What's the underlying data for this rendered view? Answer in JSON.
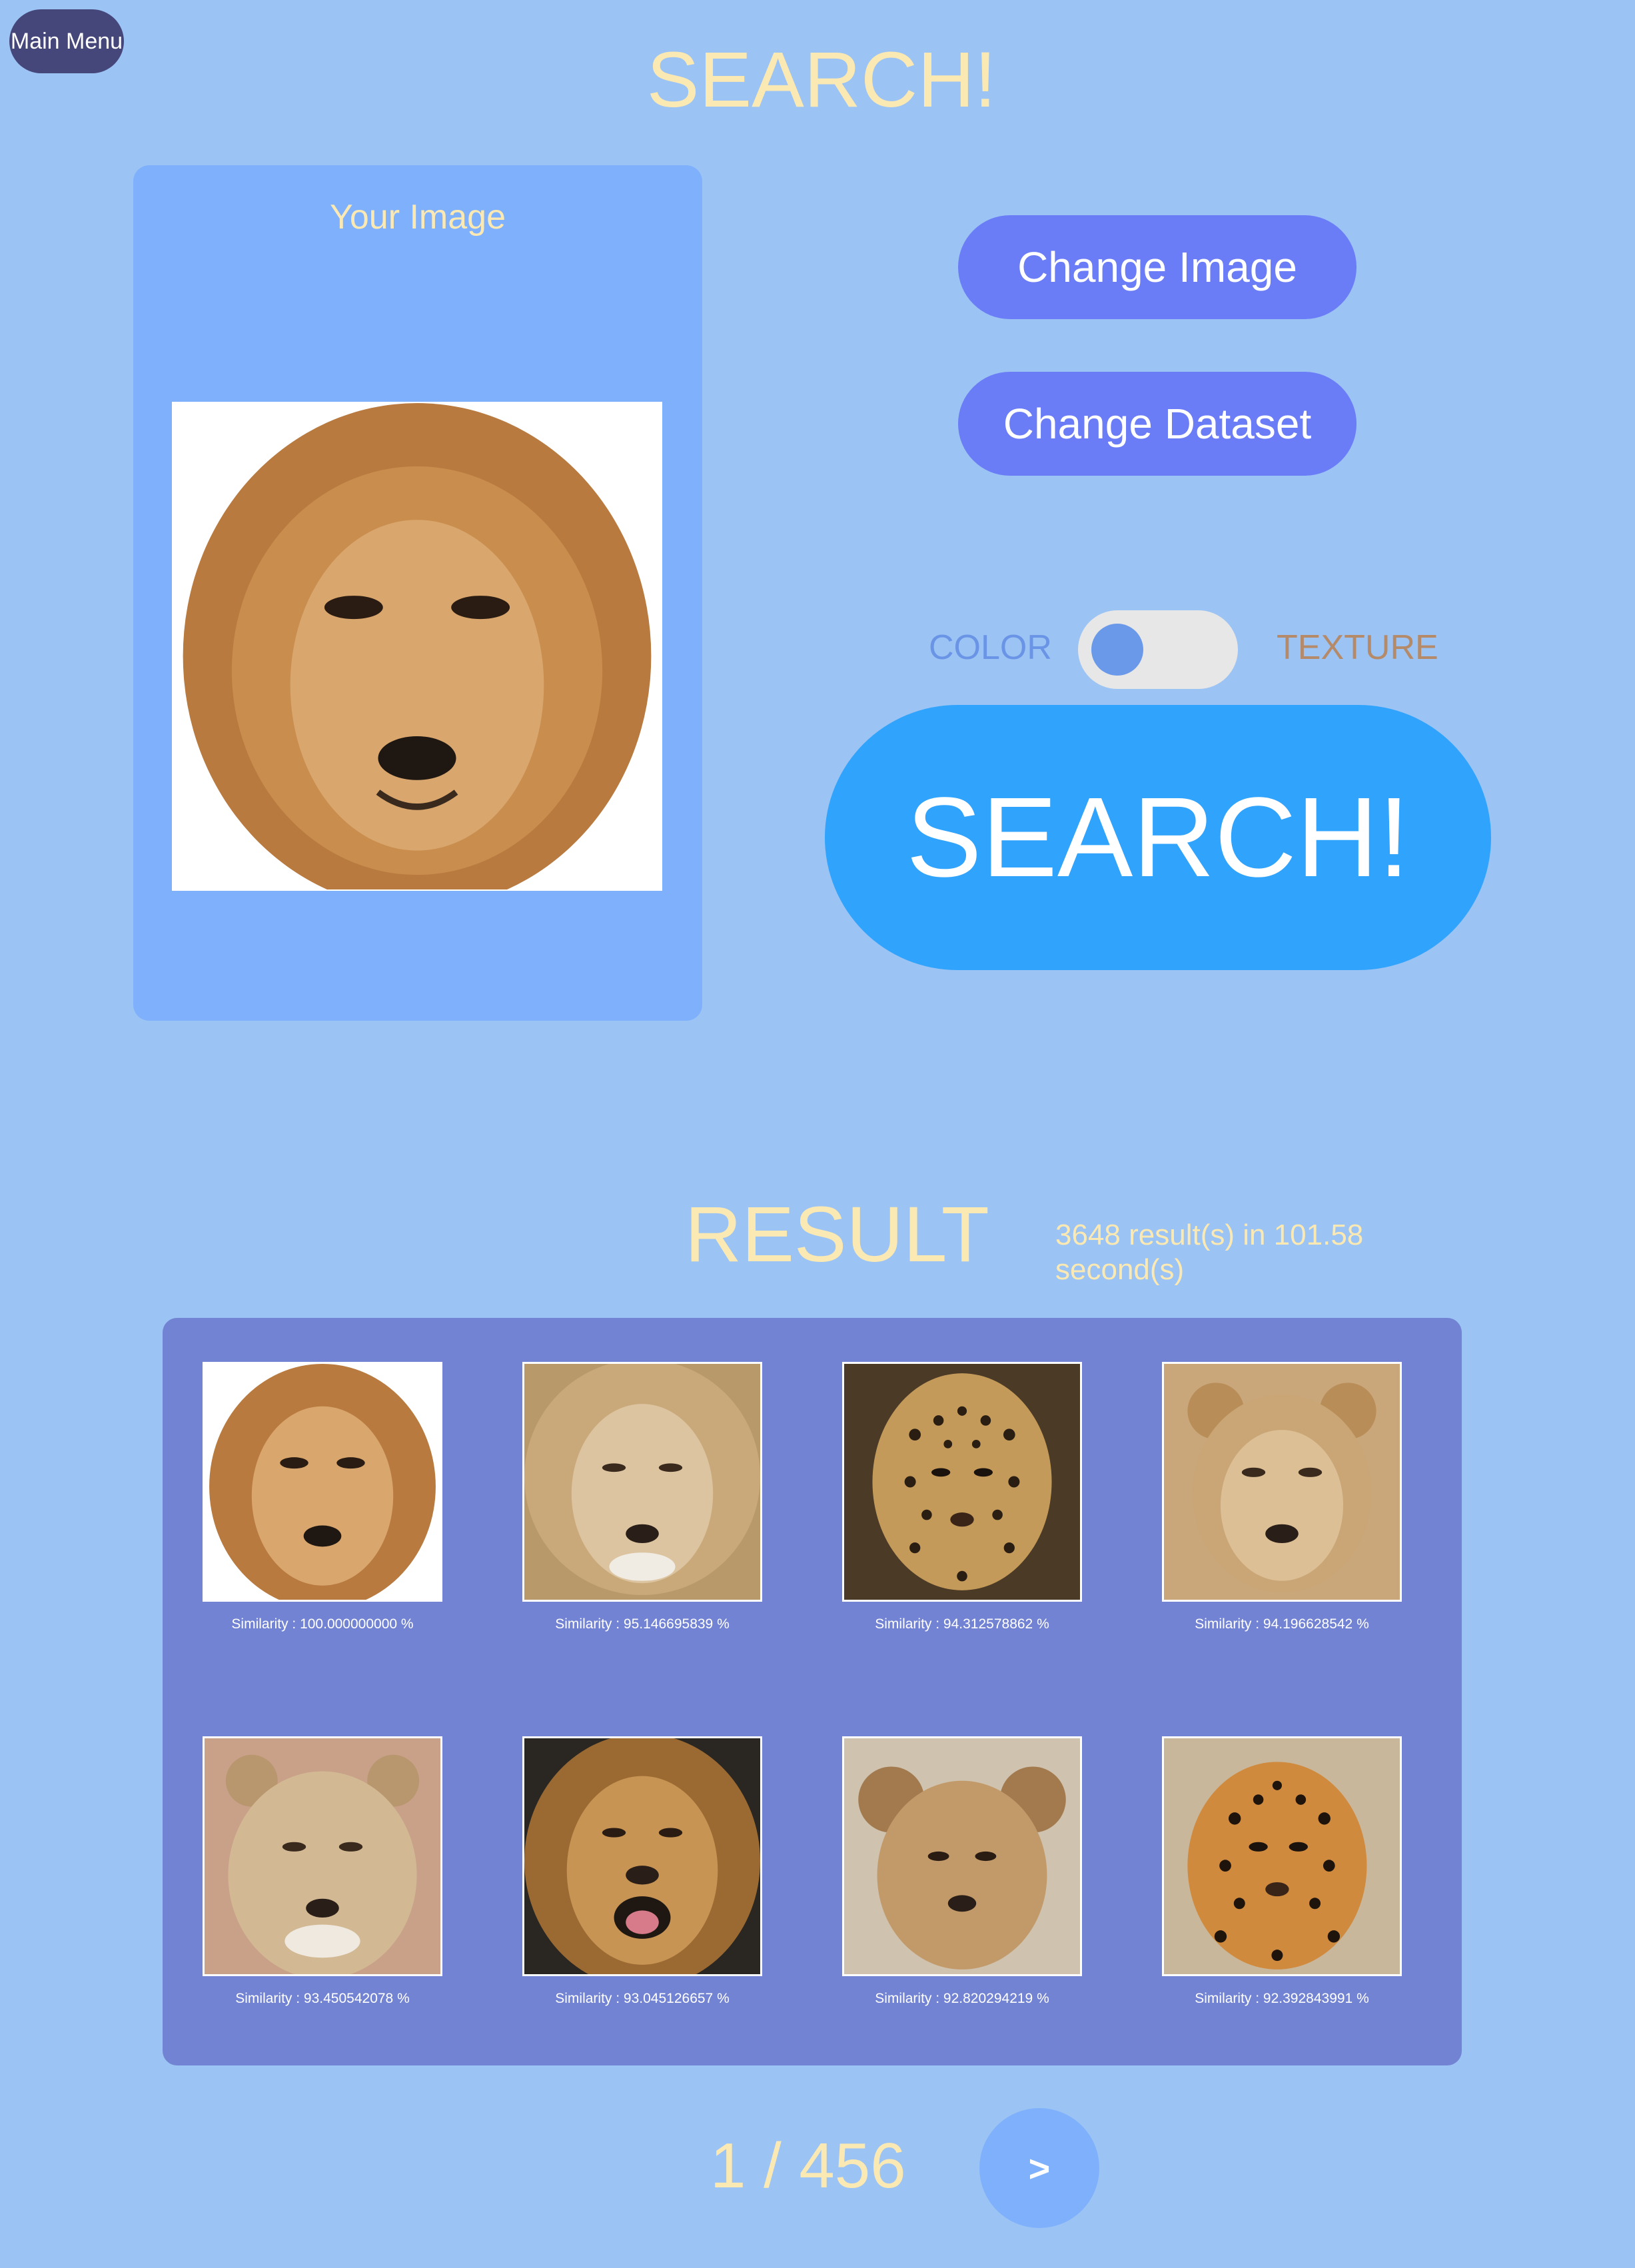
{
  "nav": {
    "main_menu_label": "Main Menu"
  },
  "page_title": "SEARCH!",
  "query_panel": {
    "label": "Your Image"
  },
  "controls": {
    "change_image_label": "Change Image",
    "change_dataset_label": "Change Dataset",
    "toggle_left_label": "COLOR",
    "toggle_right_label": "TEXTURE",
    "toggle_state": "COLOR",
    "search_label": "SEARCH!"
  },
  "results": {
    "title": "RESULT",
    "stats": "3648 result(s) in 101.58 second(s)",
    "items": [
      {
        "caption": "Similarity : 100.000000000 %",
        "thumb": "lion-face"
      },
      {
        "caption": "Similarity : 95.146695839 %",
        "thumb": "lion-face"
      },
      {
        "caption": "Similarity : 94.312578862 %",
        "thumb": "leopard-face"
      },
      {
        "caption": "Similarity : 94.196628542 %",
        "thumb": "young-lion-face"
      },
      {
        "caption": "Similarity : 93.450542078 %",
        "thumb": "lioness-face"
      },
      {
        "caption": "Similarity : 93.045126657 %",
        "thumb": "lion-roaring-face"
      },
      {
        "caption": "Similarity : 92.820294219 %",
        "thumb": "lion-cub-face"
      },
      {
        "caption": "Similarity : 92.392843991 %",
        "thumb": "jaguar-face"
      }
    ]
  },
  "pagination": {
    "indicator": "1 / 456",
    "next_label": ">"
  },
  "colors": {
    "background": "#9bc3f4",
    "accent_title": "#fbe9b3",
    "button": "#6a7cf6",
    "search_button": "#30a3fd",
    "results_panel": "#7283d3"
  }
}
